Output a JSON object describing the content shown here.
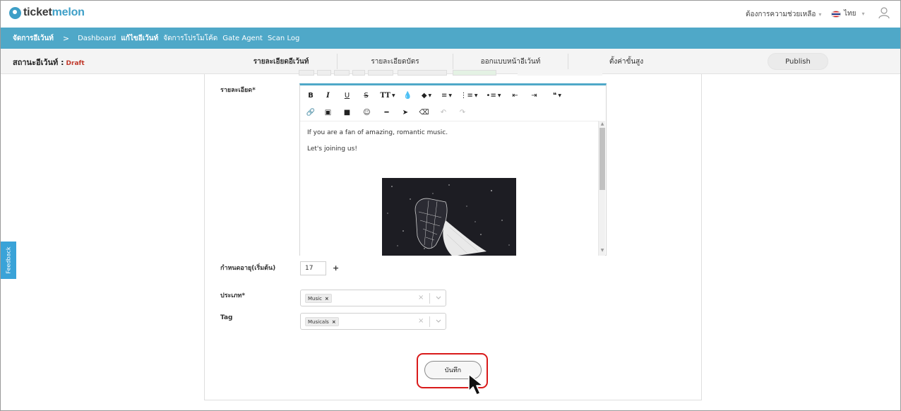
{
  "header": {
    "logo_prefix": "ticket",
    "logo_suffix": "melon",
    "help_label": "ต้องการความช่วยเหลือ",
    "language": "ไทย",
    "user_icon": "user-icon"
  },
  "nav": {
    "section": "จัดการอีเว้นท์",
    "separator": ">",
    "items": [
      {
        "label": "Dashboard"
      },
      {
        "label": "แก้ไขอีเว้นท์"
      },
      {
        "label": "จัดการโปรโมโค้ด"
      },
      {
        "label": "Gate Agent"
      },
      {
        "label": "Scan Log"
      }
    ]
  },
  "status": {
    "label": "สถานะอีเว้นท์ :",
    "value": "Draft"
  },
  "tabs": [
    {
      "label": "รายละเอียดอีเว้นท์"
    },
    {
      "label": "รายละเอียดบัตร"
    },
    {
      "label": "ออกแบบหน้าอีเว้นท์"
    },
    {
      "label": "ตั้งค่าขั้นสูง"
    }
  ],
  "publish_label": "Publish",
  "form": {
    "description_label": "รายละเอียด*",
    "editor": {
      "paragraphs": [
        "If you are a fan of amazing, romantic music.",
        "Let's joining us!"
      ],
      "toolbar_row1": [
        {
          "name": "bold-button",
          "glyph": "B"
        },
        {
          "name": "italic-button",
          "glyph": "I"
        },
        {
          "name": "underline-button",
          "glyph": "U"
        },
        {
          "name": "strikethrough-button",
          "glyph": "S"
        },
        {
          "name": "font-size-button",
          "glyph": "TT"
        },
        {
          "name": "text-color-button",
          "glyph": "💧"
        },
        {
          "name": "highlight-button",
          "glyph": "◆"
        },
        {
          "name": "align-button",
          "glyph": "≡"
        },
        {
          "name": "ordered-list-button",
          "glyph": "⋮≡"
        },
        {
          "name": "unordered-list-button",
          "glyph": "•≡"
        },
        {
          "name": "outdent-button",
          "glyph": "⇤"
        },
        {
          "name": "indent-button",
          "glyph": "⇥"
        },
        {
          "name": "quote-button",
          "glyph": "❝"
        }
      ],
      "toolbar_row2": [
        {
          "name": "link-button",
          "glyph": "🔗"
        },
        {
          "name": "image-button",
          "glyph": "▣"
        },
        {
          "name": "video-button",
          "glyph": "■"
        },
        {
          "name": "emoji-button",
          "glyph": "☺"
        },
        {
          "name": "horizontal-rule-button",
          "glyph": "━"
        },
        {
          "name": "select-button",
          "glyph": "➤"
        },
        {
          "name": "eraser-button",
          "glyph": "⌫"
        },
        {
          "name": "undo-button",
          "glyph": "↶"
        },
        {
          "name": "redo-button",
          "glyph": "↷"
        }
      ]
    },
    "age_label": "กำหนดอายุ(เริ่มต้น)",
    "age_value": "17",
    "age_suffix": "+",
    "category_label": "ประเภท*",
    "category_chip": "Music",
    "tag_label": "Tag",
    "tag_chip": "Musicals",
    "chip_remove": "×",
    "clear_glyph": "×",
    "save_label": "บันทึก"
  },
  "feedback_label": "Feedback",
  "colors": {
    "nav_bg": "#4fa8c8",
    "accent": "#3e9fc7",
    "draft": "#c0392b",
    "highlight": "#d91a1a",
    "feedback": "#3aa3d8"
  }
}
